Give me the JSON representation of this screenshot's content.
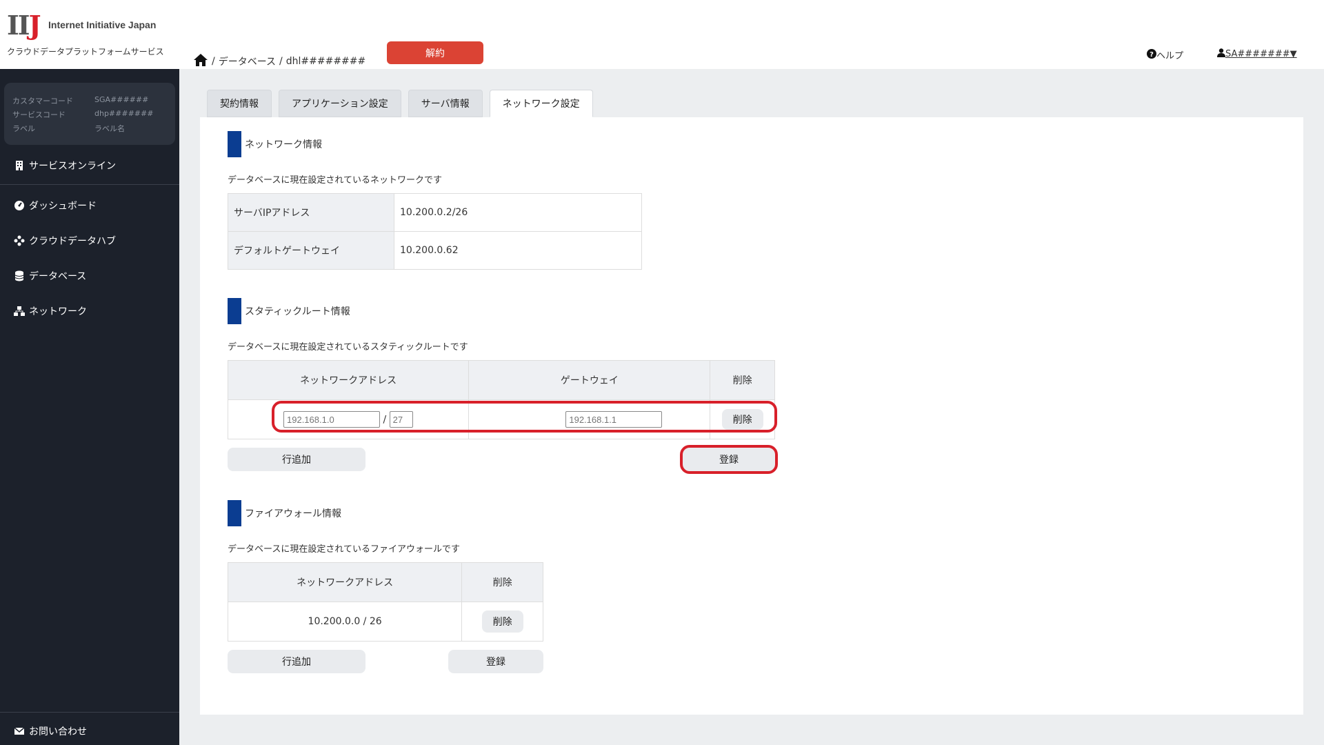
{
  "app": {
    "company": "Internet Initiative Japan",
    "logo_text": "IIJ",
    "service_name": "クラウドデータプラットフォームサービス"
  },
  "account": {
    "customer_code_label": "カスタマーコード",
    "customer_code": "SGA######",
    "service_code_label": "サービスコード",
    "service_code": "dhp#######",
    "label_label": "ラベル",
    "label_value": "ラベル名"
  },
  "sidebar": {
    "items": [
      {
        "label": "サービスオンライン",
        "icon": "building-icon"
      },
      {
        "label": "ダッシュボード",
        "icon": "gauge-icon"
      },
      {
        "label": "クラウドデータハブ",
        "icon": "hub-icon"
      },
      {
        "label": "データベース",
        "icon": "database-icon"
      },
      {
        "label": "ネットワーク",
        "icon": "network-icon"
      }
    ],
    "contact": "お問い合わせ"
  },
  "header": {
    "breadcrumb": [
      "データベース",
      "dhl########"
    ],
    "cancel_button": "解約",
    "help": "ヘルプ",
    "user": "SA#######▼"
  },
  "tabs": [
    {
      "label": "契約情報",
      "active": false
    },
    {
      "label": "アプリケーション設定",
      "active": false
    },
    {
      "label": "サーバ情報",
      "active": false
    },
    {
      "label": "ネットワーク設定",
      "active": true
    }
  ],
  "network_info": {
    "title": "ネットワーク情報",
    "description": "データベースに現在設定されているネットワークです",
    "rows": [
      {
        "key": "サーバIPアドレス",
        "value": "10.200.0.2/26"
      },
      {
        "key": "デフォルトゲートウェイ",
        "value": "10.200.0.62"
      }
    ]
  },
  "static_route": {
    "title": "スタティックルート情報",
    "description": "データベースに現在設定されているスタティックルートです",
    "headers": [
      "ネットワークアドレス",
      "ゲートウェイ",
      "削除"
    ],
    "row": {
      "address_placeholder": "192.168.1.0",
      "slash": "/",
      "prefix_placeholder": "27",
      "gateway_placeholder": "192.168.1.1",
      "delete_label": "削除"
    },
    "add_row_label": "行追加",
    "register_label": "登録"
  },
  "firewall": {
    "title": "ファイアウォール情報",
    "description": "データベースに現在設定されているファイアウォールです",
    "headers": [
      "ネットワークアドレス",
      "削除"
    ],
    "rows": [
      {
        "address": "10.200.0.0 / 26",
        "delete_label": "削除"
      }
    ],
    "add_row_label": "行追加",
    "register_label": "登録"
  },
  "colors": {
    "sidebar_bg": "#1c212b",
    "accent_blue": "#0b3d91",
    "danger_red": "#db4334",
    "highlight_red": "#d8202a"
  }
}
